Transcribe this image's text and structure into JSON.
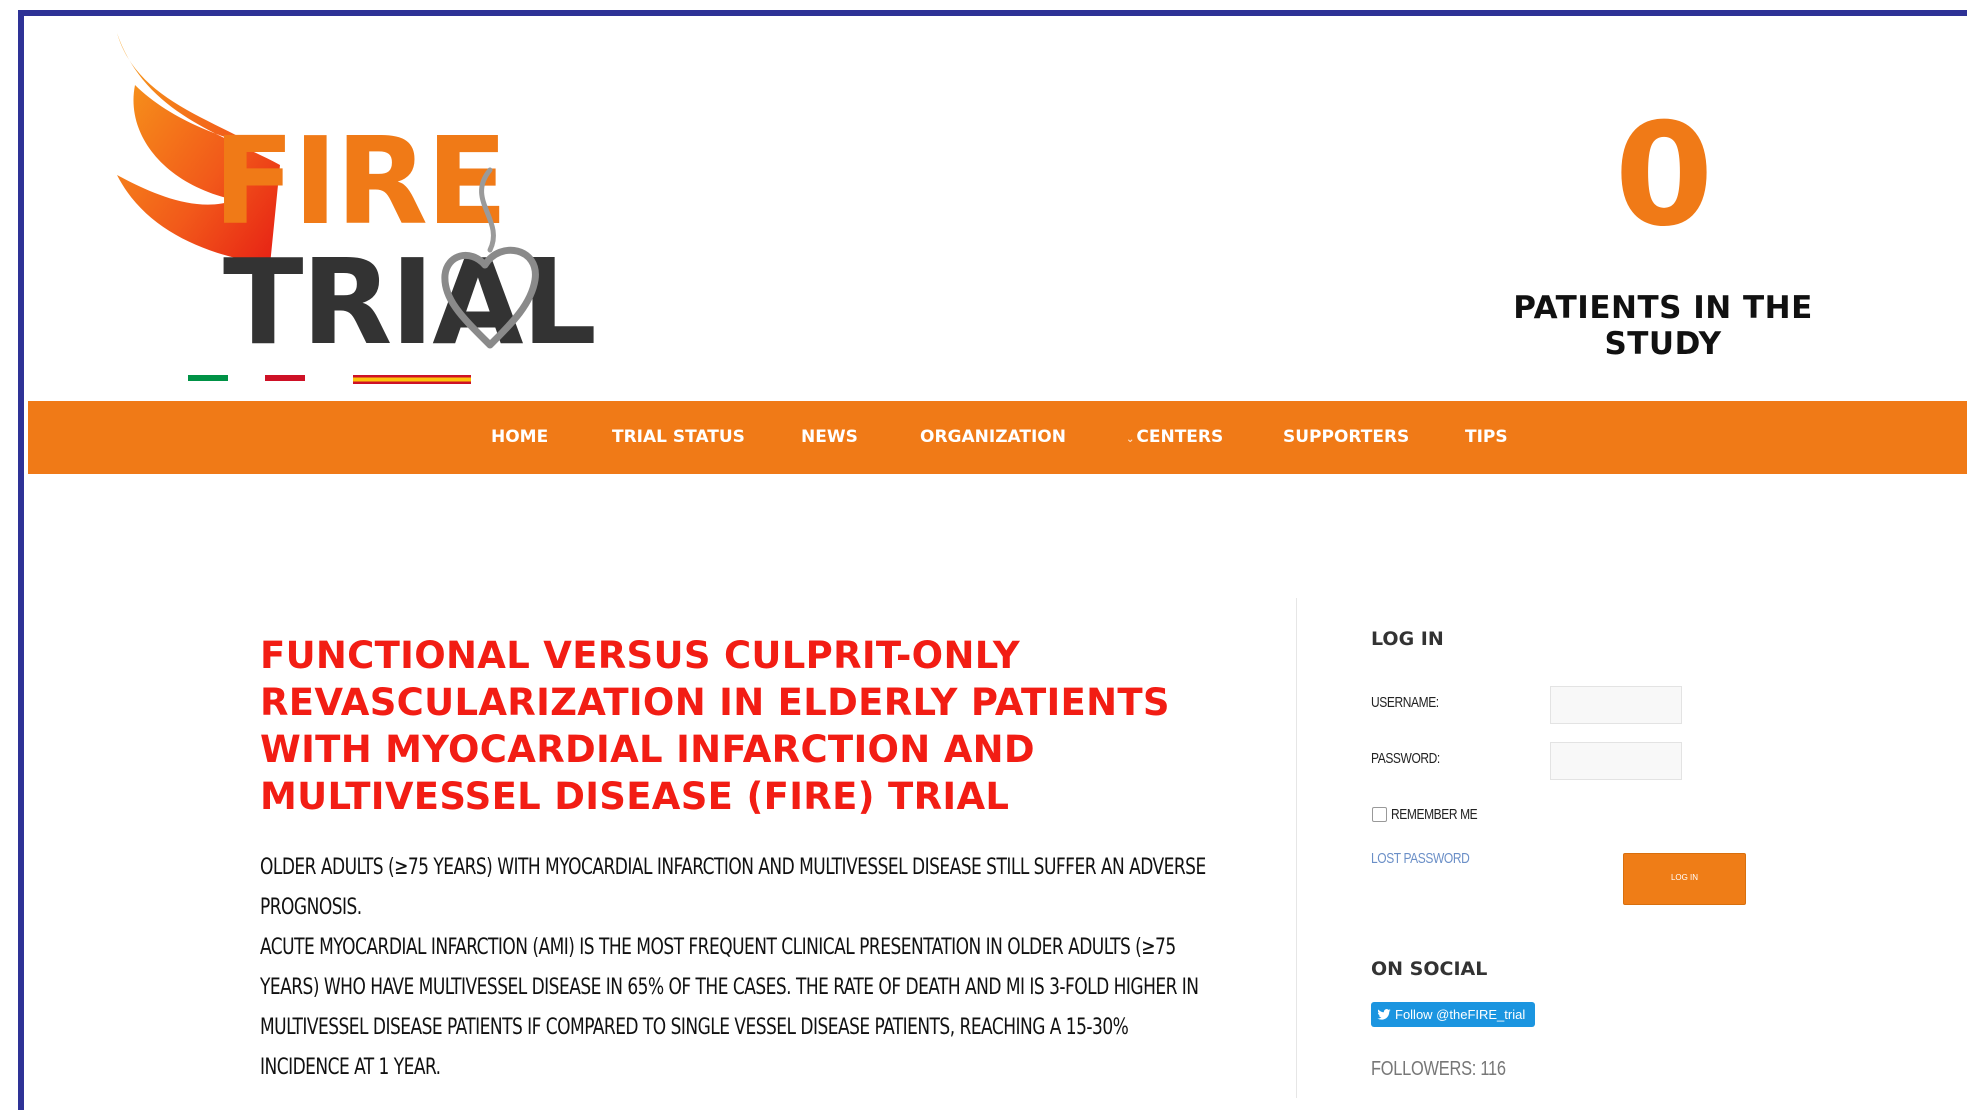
{
  "colors": {
    "frame": "#2e3296",
    "orange": "#f07a17",
    "orange_btn": "#ef7d17",
    "title_red": "#f21d14",
    "dark_text": "#333333",
    "link_blue": "#6b8fc7",
    "twitter_blue": "#1b95e0",
    "flag_green": "#009246",
    "flag_red": "#ce1126",
    "flag_yellow": "#fcc30b"
  },
  "logo": {
    "word_top": "FIRE",
    "word_bottom": "TRIAL",
    "icons": [
      "flame-icon",
      "heart-smoke-icon"
    ]
  },
  "counter": {
    "value": "0",
    "label": "PATIENTS IN THE STUDY"
  },
  "nav": {
    "items": [
      {
        "label": "HOME"
      },
      {
        "label": "TRIAL STATUS"
      },
      {
        "label": "NEWS"
      },
      {
        "label": "ORGANIZATION"
      },
      {
        "label": "CENTERS",
        "has_dropdown": true
      },
      {
        "label": "SUPPORTERS"
      },
      {
        "label": "TIPS"
      }
    ]
  },
  "main": {
    "title": "FUNCTIONAL VERSUS CULPRIT-ONLY REVASCULARIZATION IN ELDERLY PATIENTS WITH MYOCARDIAL INFARCTION AND MULTIVESSEL DISEASE (FIRE) TRIAL",
    "paragraphs": [
      "OLDER ADULTS (≥75 YEARS) WITH MYOCARDIAL INFARCTION AND MULTIVESSEL DISEASE STILL SUFFER AN ADVERSE PROGNOSIS.",
      "ACUTE MYOCARDIAL INFARCTION (AMI) IS THE MOST FREQUENT CLINICAL PRESENTATION IN OLDER ADULTS (≥75 YEARS) WHO HAVE MULTIVESSEL DISEASE IN 65% OF THE CASES. THE RATE OF DEATH AND MI IS 3-FOLD HIGHER IN MULTIVESSEL DISEASE PATIENTS IF COMPARED TO SINGLE VESSEL DISEASE PATIENTS, REACHING A 15-30% INCIDENCE AT 1 YEAR."
    ]
  },
  "login": {
    "heading": "LOG IN",
    "username_label": "USERNAME:",
    "username_value": "",
    "password_label": "PASSWORD:",
    "password_value": "",
    "remember_label": "REMEMBER ME",
    "remember_checked": false,
    "lost_password": "LOST PASSWORD",
    "button": "LOG IN"
  },
  "social": {
    "heading": "ON SOCIAL",
    "follow_button": "Follow @theFIRE_trial",
    "followers": "FOLLOWERS: 116"
  }
}
